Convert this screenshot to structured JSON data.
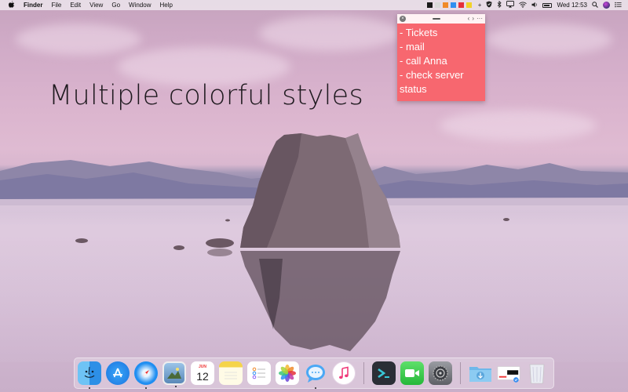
{
  "menubar": {
    "apple": "",
    "app_name": "Finder",
    "menus": [
      "File",
      "Edit",
      "View",
      "Go",
      "Window",
      "Help"
    ],
    "note_colors": [
      "#1a1a1a",
      "#d9d9d9",
      "#f08a2a",
      "#2f8ff0",
      "#e5303a",
      "#f2d228"
    ],
    "clock": "Wed 12:53"
  },
  "headline": "Multiple colorful styles",
  "note": {
    "color": "#f7676f",
    "lines": [
      "- Tickets",
      "- mail",
      "- call Anna",
      "- check server",
      "status"
    ],
    "close_glyph": "×",
    "back_glyph": "‹",
    "forward_glyph": "›",
    "more_glyph": "···"
  },
  "dock": {
    "apps": [
      {
        "name": "finder",
        "running": true
      },
      {
        "name": "app-store",
        "running": false
      },
      {
        "name": "safari",
        "running": true
      },
      {
        "name": "preview",
        "running": true
      },
      {
        "name": "calendar",
        "running": false,
        "month": "JUN",
        "day": "12"
      },
      {
        "name": "notes",
        "running": false
      },
      {
        "name": "reminders",
        "running": false
      },
      {
        "name": "photos",
        "running": false
      },
      {
        "name": "messages",
        "running": true
      },
      {
        "name": "itunes",
        "running": false
      },
      {
        "name": "terminal",
        "running": false
      },
      {
        "name": "facetime",
        "running": false
      },
      {
        "name": "system-preferences",
        "running": false
      },
      {
        "name": "downloads-folder",
        "running": false
      },
      {
        "name": "screenshot-stack",
        "running": false
      },
      {
        "name": "trash",
        "running": false
      }
    ]
  }
}
